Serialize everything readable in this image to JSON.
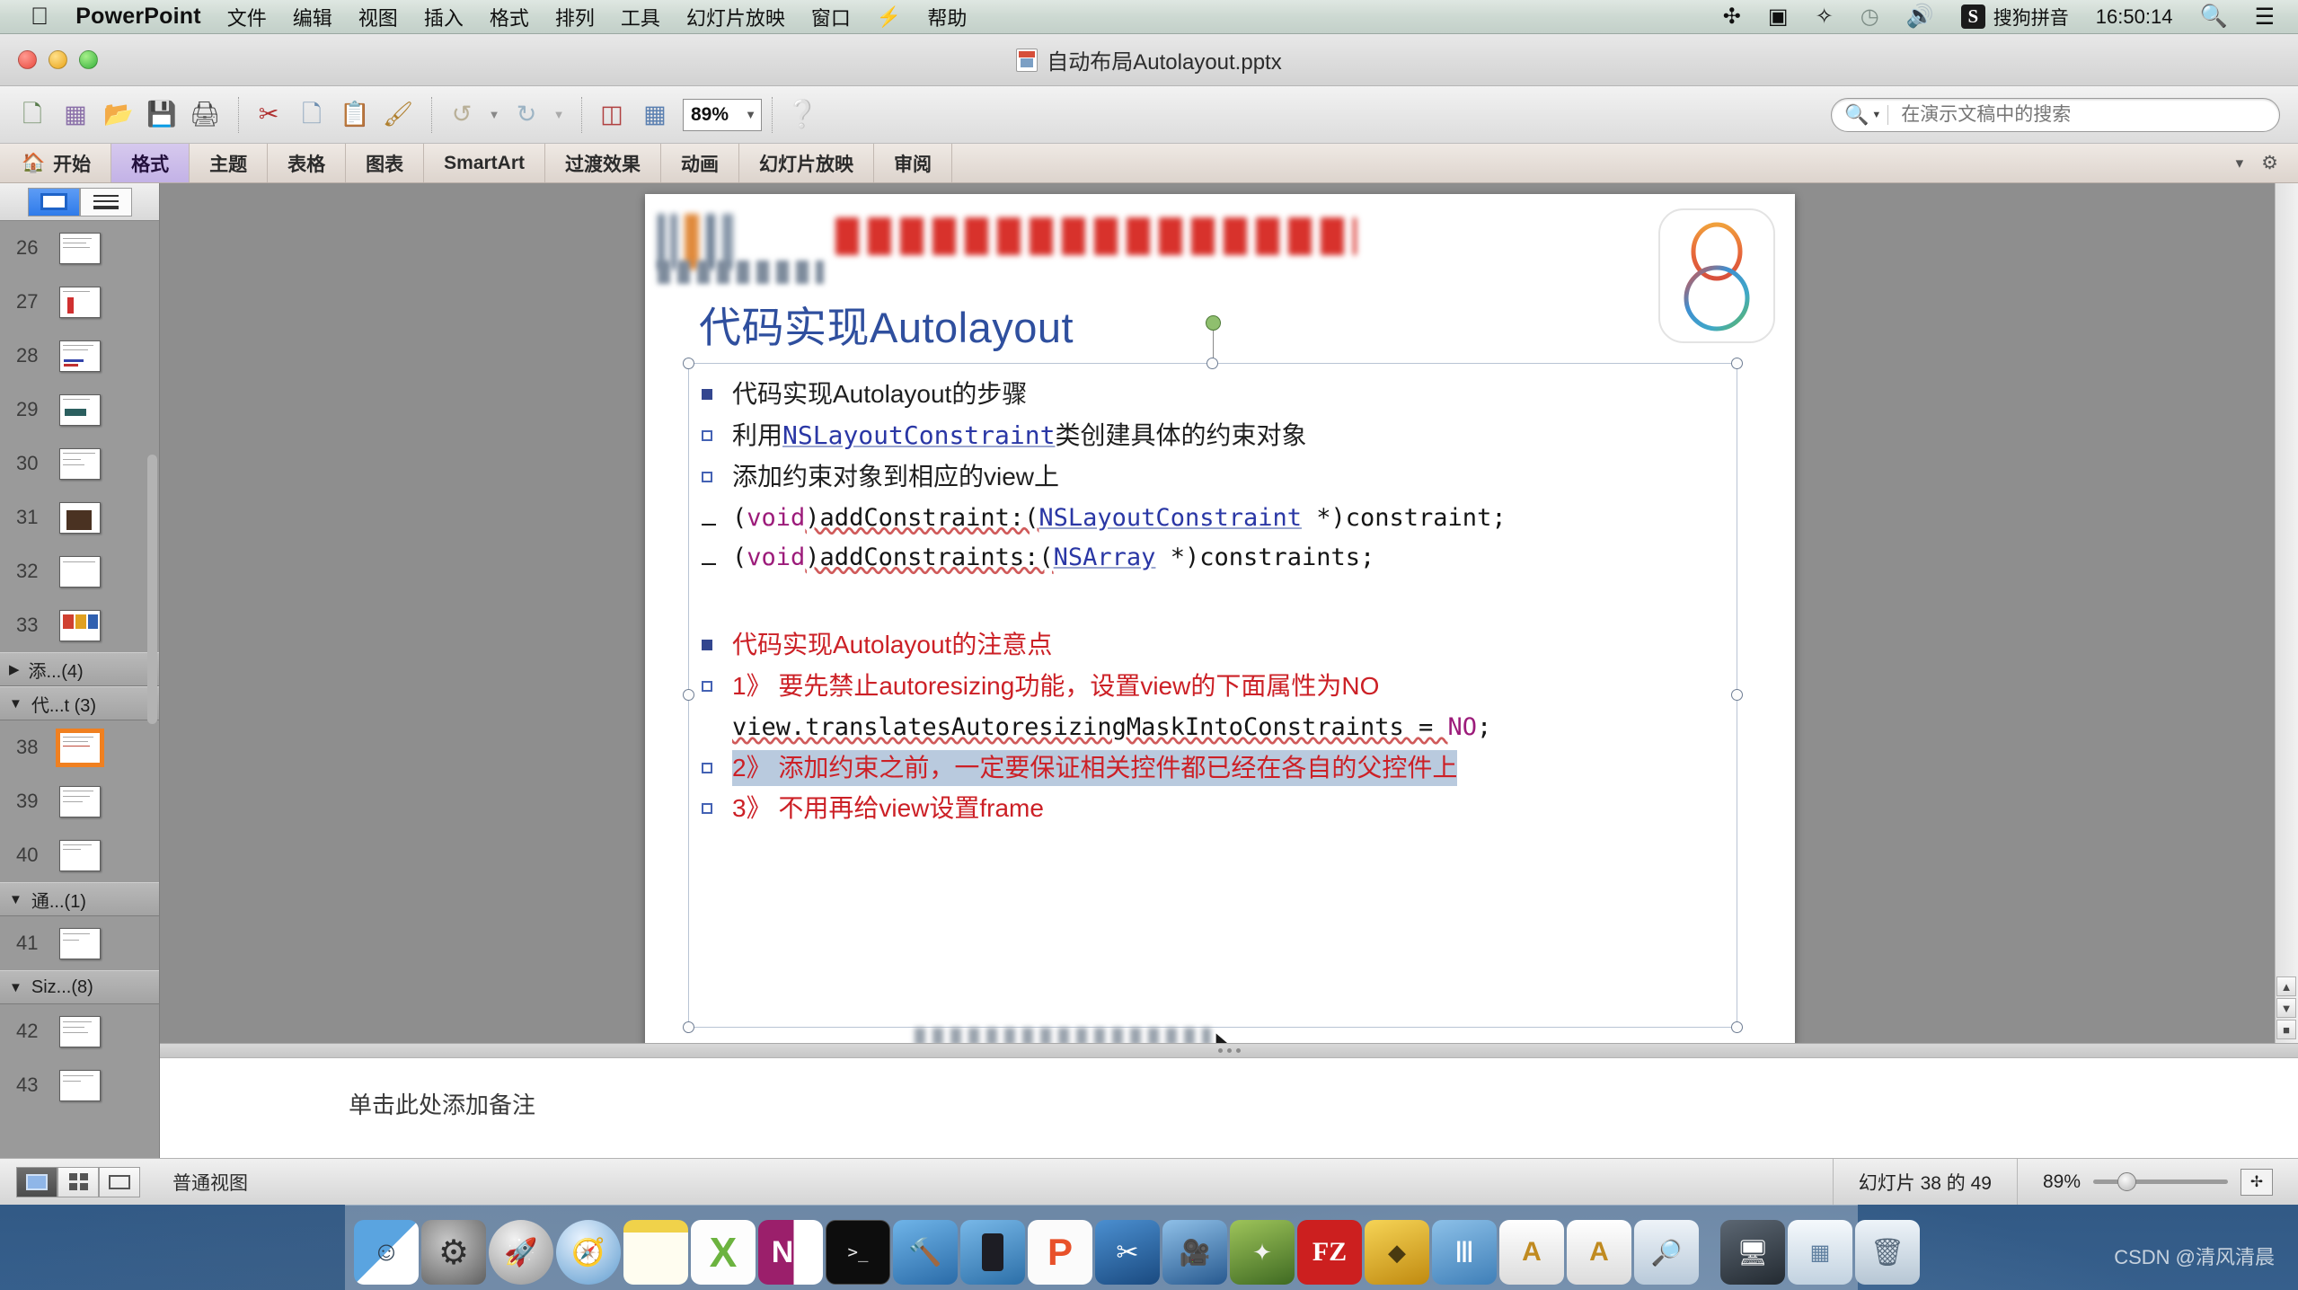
{
  "menubar": {
    "apple_icon": "apple-logo",
    "app_name": "PowerPoint",
    "menus": [
      "文件",
      "编辑",
      "视图",
      "插入",
      "格式",
      "排列",
      "工具",
      "幻灯片放映",
      "窗口"
    ],
    "help_label": "帮助",
    "status_icons": [
      "bluetooth-icon",
      "screen-record-icon",
      "dropbox-icon",
      "clock-icon",
      "volume-icon"
    ],
    "input_method_badge": "S",
    "input_method_name": "搜狗拼音",
    "clock": "16:50:14",
    "spotlight_icon": "search-icon",
    "notification_icon": "list-icon"
  },
  "titlebar": {
    "document_title": "自动布局Autolayout.pptx",
    "close_label": "close-button",
    "minimize_label": "minimize-button",
    "zoom_label": "zoom-button"
  },
  "toolbar": {
    "buttons": [
      {
        "name": "new-presentation",
        "glyph": "🗋"
      },
      {
        "name": "media-browser",
        "glyph": "▦"
      },
      {
        "name": "open-file",
        "glyph": "🗀"
      },
      {
        "name": "save-file",
        "glyph": "▤"
      },
      {
        "name": "print",
        "glyph": "🖶"
      },
      {
        "name": "cut",
        "glyph": "✂"
      },
      {
        "name": "copy",
        "glyph": "🗐"
      },
      {
        "name": "paste",
        "glyph": "📋"
      },
      {
        "name": "format-painter",
        "glyph": "🖌"
      },
      {
        "name": "undo",
        "glyph": "↺"
      },
      {
        "name": "redo",
        "glyph": "↻"
      },
      {
        "name": "new-slide",
        "glyph": "▤"
      },
      {
        "name": "smart-art",
        "glyph": "◪"
      }
    ],
    "zoom_value": "89%",
    "help_glyph": "?"
  },
  "search": {
    "placeholder": "在演示文稿中的搜索",
    "value": ""
  },
  "ribbon": {
    "tabs": [
      {
        "label": "开始",
        "active": false,
        "home": true
      },
      {
        "label": "格式",
        "active": true
      },
      {
        "label": "主题",
        "active": false
      },
      {
        "label": "表格",
        "active": false
      },
      {
        "label": "图表",
        "active": false
      },
      {
        "label": "SmartArt",
        "active": false
      },
      {
        "label": "过渡效果",
        "active": false
      },
      {
        "label": "动画",
        "active": false
      },
      {
        "label": "幻灯片放映",
        "active": false
      },
      {
        "label": "审阅",
        "active": false
      }
    ],
    "collapse_icon": "chevron-down-icon",
    "settings_icon": "gear-icon"
  },
  "sidebar": {
    "view_normal_icon": "slide-view-icon",
    "view_outline_icon": "outline-view-icon",
    "slides": [
      {
        "number": "26",
        "selected": false
      },
      {
        "number": "27",
        "selected": false
      },
      {
        "number": "28",
        "selected": false
      },
      {
        "number": "29",
        "selected": false
      },
      {
        "number": "30",
        "selected": false
      },
      {
        "number": "31",
        "selected": false
      },
      {
        "number": "32",
        "selected": false
      },
      {
        "number": "33",
        "selected": false
      }
    ],
    "groups": [
      {
        "label": "添...(4)",
        "expanded": false
      },
      {
        "label": "代...t (3)",
        "expanded": true,
        "slides": [
          {
            "number": "38",
            "selected": true
          },
          {
            "number": "39",
            "selected": false
          },
          {
            "number": "40",
            "selected": false
          }
        ]
      },
      {
        "label": "通...(1)",
        "expanded": true,
        "slides": [
          {
            "number": "41",
            "selected": false
          }
        ]
      },
      {
        "label": "Siz...(8)",
        "expanded": true,
        "slides": [
          {
            "number": "42",
            "selected": false
          },
          {
            "number": "43",
            "selected": false
          }
        ]
      }
    ]
  },
  "slide": {
    "title": "代码实现Autolayout",
    "logo_name": "ios8-logo",
    "bullets": [
      {
        "marker": "square-filled",
        "color": "blue",
        "text": "代码实现Autolayout的步骤"
      },
      {
        "marker": "square-hollow",
        "color": "blue",
        "text_parts": [
          {
            "t": "利用",
            "style": "plain"
          },
          {
            "t": "NSLayoutConstraint",
            "style": "class"
          },
          {
            "t": "类创建具体的约束对象",
            "style": "plain"
          }
        ]
      },
      {
        "marker": "square-hollow",
        "color": "blue",
        "text": "添加约束对象到相应的view上"
      },
      {
        "marker": "dash",
        "code": true,
        "parts": [
          {
            "t": "(",
            "style": "plain"
          },
          {
            "t": "void",
            "style": "kw"
          },
          {
            "t": ")addConstraint:(",
            "style": "plain"
          },
          {
            "t": "NSLayoutConstraint",
            "style": "class"
          },
          {
            "t": " *)constraint;",
            "style": "plain"
          }
        ]
      },
      {
        "marker": "dash",
        "code": true,
        "parts": [
          {
            "t": "(",
            "style": "plain"
          },
          {
            "t": "void",
            "style": "kw"
          },
          {
            "t": ")addConstraints:(",
            "style": "plain"
          },
          {
            "t": "NSArray",
            "style": "class"
          },
          {
            "t": " *)constraints;",
            "style": "plain"
          }
        ]
      },
      {
        "marker": "blank"
      },
      {
        "marker": "square-filled",
        "color": "red",
        "text": "代码实现Autolayout的注意点"
      },
      {
        "marker": "square-hollow",
        "color": "blue",
        "text": "1》 要先禁止autoresizing功能，设置view的下面属性为NO",
        "red": true
      },
      {
        "marker": "none",
        "code": true,
        "parts": [
          {
            "t": "view.translatesAutoresizingMaskIntoConstraints = ",
            "style": "plain"
          },
          {
            "t": "NO",
            "style": "kw"
          },
          {
            "t": ";",
            "style": "plain"
          }
        ]
      },
      {
        "marker": "square-hollow",
        "color": "blue",
        "text": "2》 添加约束之前，一定要保证相关控件都已经在各自的父控件上",
        "red": true,
        "highlight": true
      },
      {
        "marker": "square-hollow",
        "color": "blue",
        "text": "3》 不用再给view设置frame",
        "red": true
      }
    ]
  },
  "notes": {
    "placeholder": "单击此处添加备注"
  },
  "statusbar": {
    "view_buttons": [
      "normal-view-icon",
      "slide-sorter-icon",
      "presenter-view-icon"
    ],
    "view_label": "普通视图",
    "slide_counter": "幻灯片 38 的 49",
    "zoom_value": "89%",
    "fit_icon": "fit-to-window-icon"
  },
  "dock": {
    "items": [
      {
        "name": "finder",
        "color1": "#5aa4e0",
        "color2": "#ffffff",
        "glyph": "☺",
        "running": true
      },
      {
        "name": "system-preferences",
        "color1": "#9b9b9b",
        "color2": "#5e5e5e",
        "glyph": "⚙",
        "running": false
      },
      {
        "name": "launchpad",
        "color1": "#d4d4d4",
        "color2": "#9a9a9a",
        "glyph": "🚀",
        "running": false
      },
      {
        "name": "safari",
        "color1": "#cfe4f5",
        "color2": "#6fa6d8",
        "glyph": "🧭",
        "running": false
      },
      {
        "name": "notes",
        "color1": "#fff6c8",
        "color2": "#f3d55a",
        "glyph": "▤",
        "running": false
      },
      {
        "name": "excel",
        "color1": "#ffffff",
        "color2": "#6cb33f",
        "glyph": "X",
        "running": false
      },
      {
        "name": "onenote",
        "color1": "#ffffff",
        "color2": "#9b1f6b",
        "glyph": "N",
        "running": false
      },
      {
        "name": "terminal",
        "color1": "#1a1a1a",
        "color2": "#000000",
        "glyph": ">_",
        "running": false
      },
      {
        "name": "xcode",
        "color1": "#3f8fd0",
        "color2": "#2a6ba8",
        "glyph": "🔨",
        "running": true
      },
      {
        "name": "simulator",
        "color1": "#4b95d2",
        "color2": "#2c6fa8",
        "glyph": "▯",
        "running": true
      },
      {
        "name": "pycharm",
        "color1": "#ffffff",
        "color2": "#e8512a",
        "glyph": "P",
        "running": true
      },
      {
        "name": "snipping-tool",
        "color1": "#2e6fb0",
        "color2": "#1a4a80",
        "glyph": "✂",
        "running": false
      },
      {
        "name": "quicktime",
        "color1": "#6fa6d8",
        "color2": "#27598f",
        "glyph": "🎥",
        "running": true
      },
      {
        "name": "fifo-app",
        "color1": "#8db34a",
        "color2": "#4f7a2a",
        "glyph": "◆",
        "running": false
      },
      {
        "name": "filezilla",
        "color1": "#cc1f1f",
        "color2": "#a01313",
        "glyph": "FZ",
        "running": false
      },
      {
        "name": "sketch",
        "color1": "#f0c030",
        "color2": "#c99a18",
        "glyph": "◈",
        "running": false
      },
      {
        "name": "sublime-text",
        "color1": "#6fa6d8",
        "color2": "#3f7fb8",
        "glyph": "Ⅲ",
        "running": false
      },
      {
        "name": "app-store-a",
        "color1": "#f4f4f4",
        "color2": "#d2d2d2",
        "glyph": "A",
        "running": true
      },
      {
        "name": "app-store-b",
        "color1": "#f4f4f4",
        "color2": "#d2d2d2",
        "glyph": "A",
        "running": true
      },
      {
        "name": "preview",
        "color1": "#e8e8e8",
        "color2": "#b0c8dd",
        "glyph": "🖼",
        "running": true
      },
      {
        "name": "remote-desktop",
        "color1": "#444c55",
        "color2": "#1e242b",
        "glyph": "🖥",
        "running": false
      },
      {
        "name": "downloads-stack",
        "color1": "#eef3f8",
        "color2": "#b9c8d6",
        "glyph": "▤",
        "running": false
      },
      {
        "name": "trash",
        "color1": "#dfe8f0",
        "color2": "#aebcc9",
        "glyph": "🗑",
        "running": false
      }
    ]
  },
  "watermark": {
    "text": "CSDN @清风清晨"
  }
}
